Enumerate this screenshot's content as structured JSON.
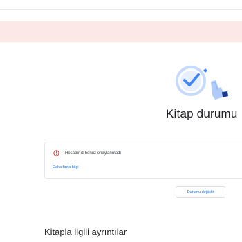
{
  "page": {
    "title": "Kitap durumu"
  },
  "status_card": {
    "message": "Hesabınız henüz onaylanmadı",
    "more_info_link": "Daha fazla bilgi"
  },
  "actions": {
    "change_status_label": "Durumu değiştir"
  },
  "section": {
    "book_details_title": "Kitapla ilgili ayrıntılar"
  },
  "colors": {
    "alert_banner": "#fce8e6",
    "accent": "#1a73e8",
    "error": "#d93025"
  },
  "icons": {
    "illustration": "check-circle-hand-illustration",
    "status": "error-circle-icon"
  }
}
